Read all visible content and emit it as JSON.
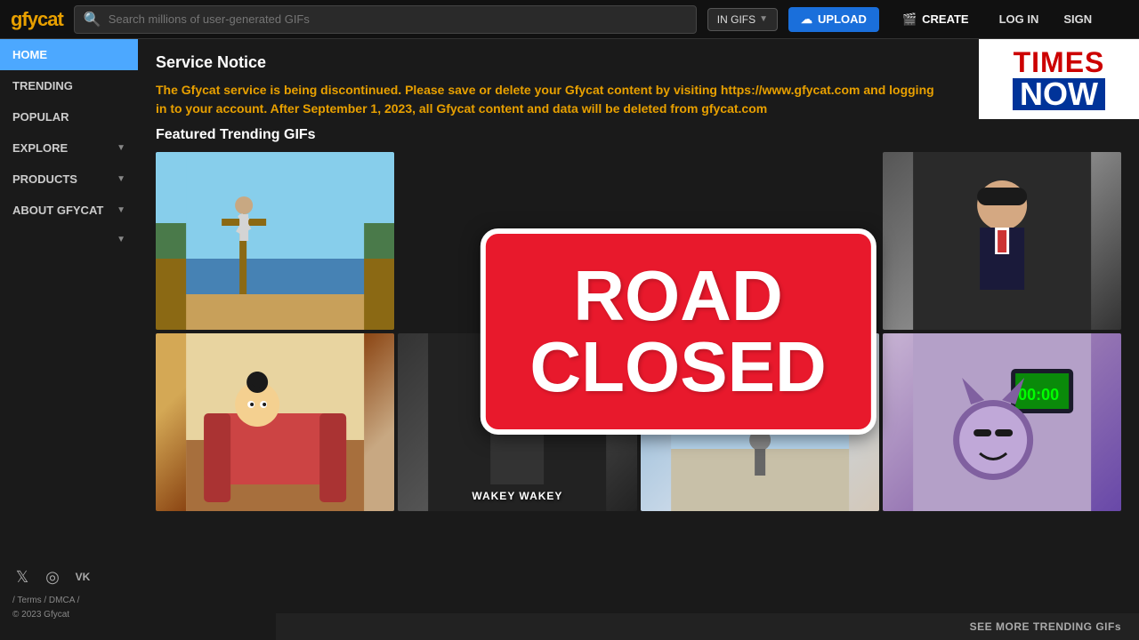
{
  "header": {
    "logo": "gfycat",
    "search_placeholder": "Search millions of user-generated GIFs",
    "in_gifs_label": "IN GIFS",
    "upload_label": "UPLOAD",
    "create_label": "CREATE",
    "login_label": "LOG IN",
    "sign_label": "SIGN"
  },
  "sidebar": {
    "items": [
      {
        "label": "HOME",
        "active": true
      },
      {
        "label": "TRENDING",
        "active": false
      },
      {
        "label": "POPULAR",
        "active": false
      },
      {
        "label": "EXPLORE",
        "active": false,
        "has_chevron": true
      },
      {
        "label": "PRODUCTS",
        "active": false,
        "has_chevron": true
      },
      {
        "label": "ABOUT GFYCAT",
        "active": false,
        "has_chevron": true
      },
      {
        "label": "",
        "active": false,
        "has_chevron": true
      }
    ],
    "footer": {
      "links": "/ Terms / DMCA /",
      "brand": "© 2023 Gfycat"
    }
  },
  "times_now": {
    "times": "TIMES",
    "now": "NOW"
  },
  "service_notice": {
    "title": "Service Notice",
    "message": "The Gfycat service is being discontinued. Please save or delete your Gfycat content by visiting https://www.gfycat.com and logging in to your account. After September 1, 2023, all Gfycat content and data will be deleted from gfycat.com"
  },
  "featured": {
    "title": "Featured Trending GIFs"
  },
  "road_closed": {
    "line1": "ROAD",
    "line2": "CLOSED"
  },
  "wakey_label": "WAKEY WAKEY",
  "see_more_label": "SEE MORE TRENDING GIFs"
}
